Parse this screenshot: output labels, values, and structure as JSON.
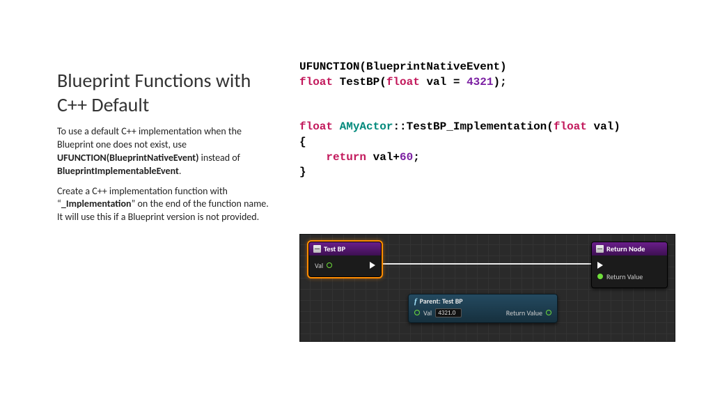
{
  "left": {
    "title": "Blueprint Functions with C++ Default",
    "para1_a": "To use a default C++ implementation when the Blueprint one does not exist, use ",
    "para1_b": "UFUNCTION(BlueprintNativeEvent)",
    "para1_c": " instead of ",
    "para1_d": "BlueprintImplementableEvent",
    "para1_e": ".",
    "para2_a": "Create a C++ implementation function with “",
    "para2_b": "_Implementation",
    "para2_c": "” on the end of the function name. It will use this if a Blueprint version is not provided."
  },
  "code": {
    "l1_a": "UFUNCTION(BlueprintNativeEvent)",
    "l2_type1": "float",
    "l2_name": " TestBP(",
    "l2_type2": "float",
    "l2_param": " val = ",
    "l2_num": "4321",
    "l2_end": ");",
    "l4_type1": "float",
    "l4_class": " AMyActor",
    "l4_mid": "::TestBP_Implementation(",
    "l4_type2": "float",
    "l4_end": " val)",
    "l5": "{",
    "l6_ret": "    return",
    "l6_mid": " val+",
    "l6_num": "60",
    "l6_end": ";",
    "l7": "}"
  },
  "bp": {
    "node1": {
      "title": "Test BP",
      "in_pin": "Val"
    },
    "node2": {
      "title": "Return Node",
      "out_pin": "Return Value"
    },
    "compact": {
      "title": "Parent: Test BP",
      "in_label": "Val",
      "in_value": "4321.0",
      "out_label": "Return Value"
    }
  }
}
